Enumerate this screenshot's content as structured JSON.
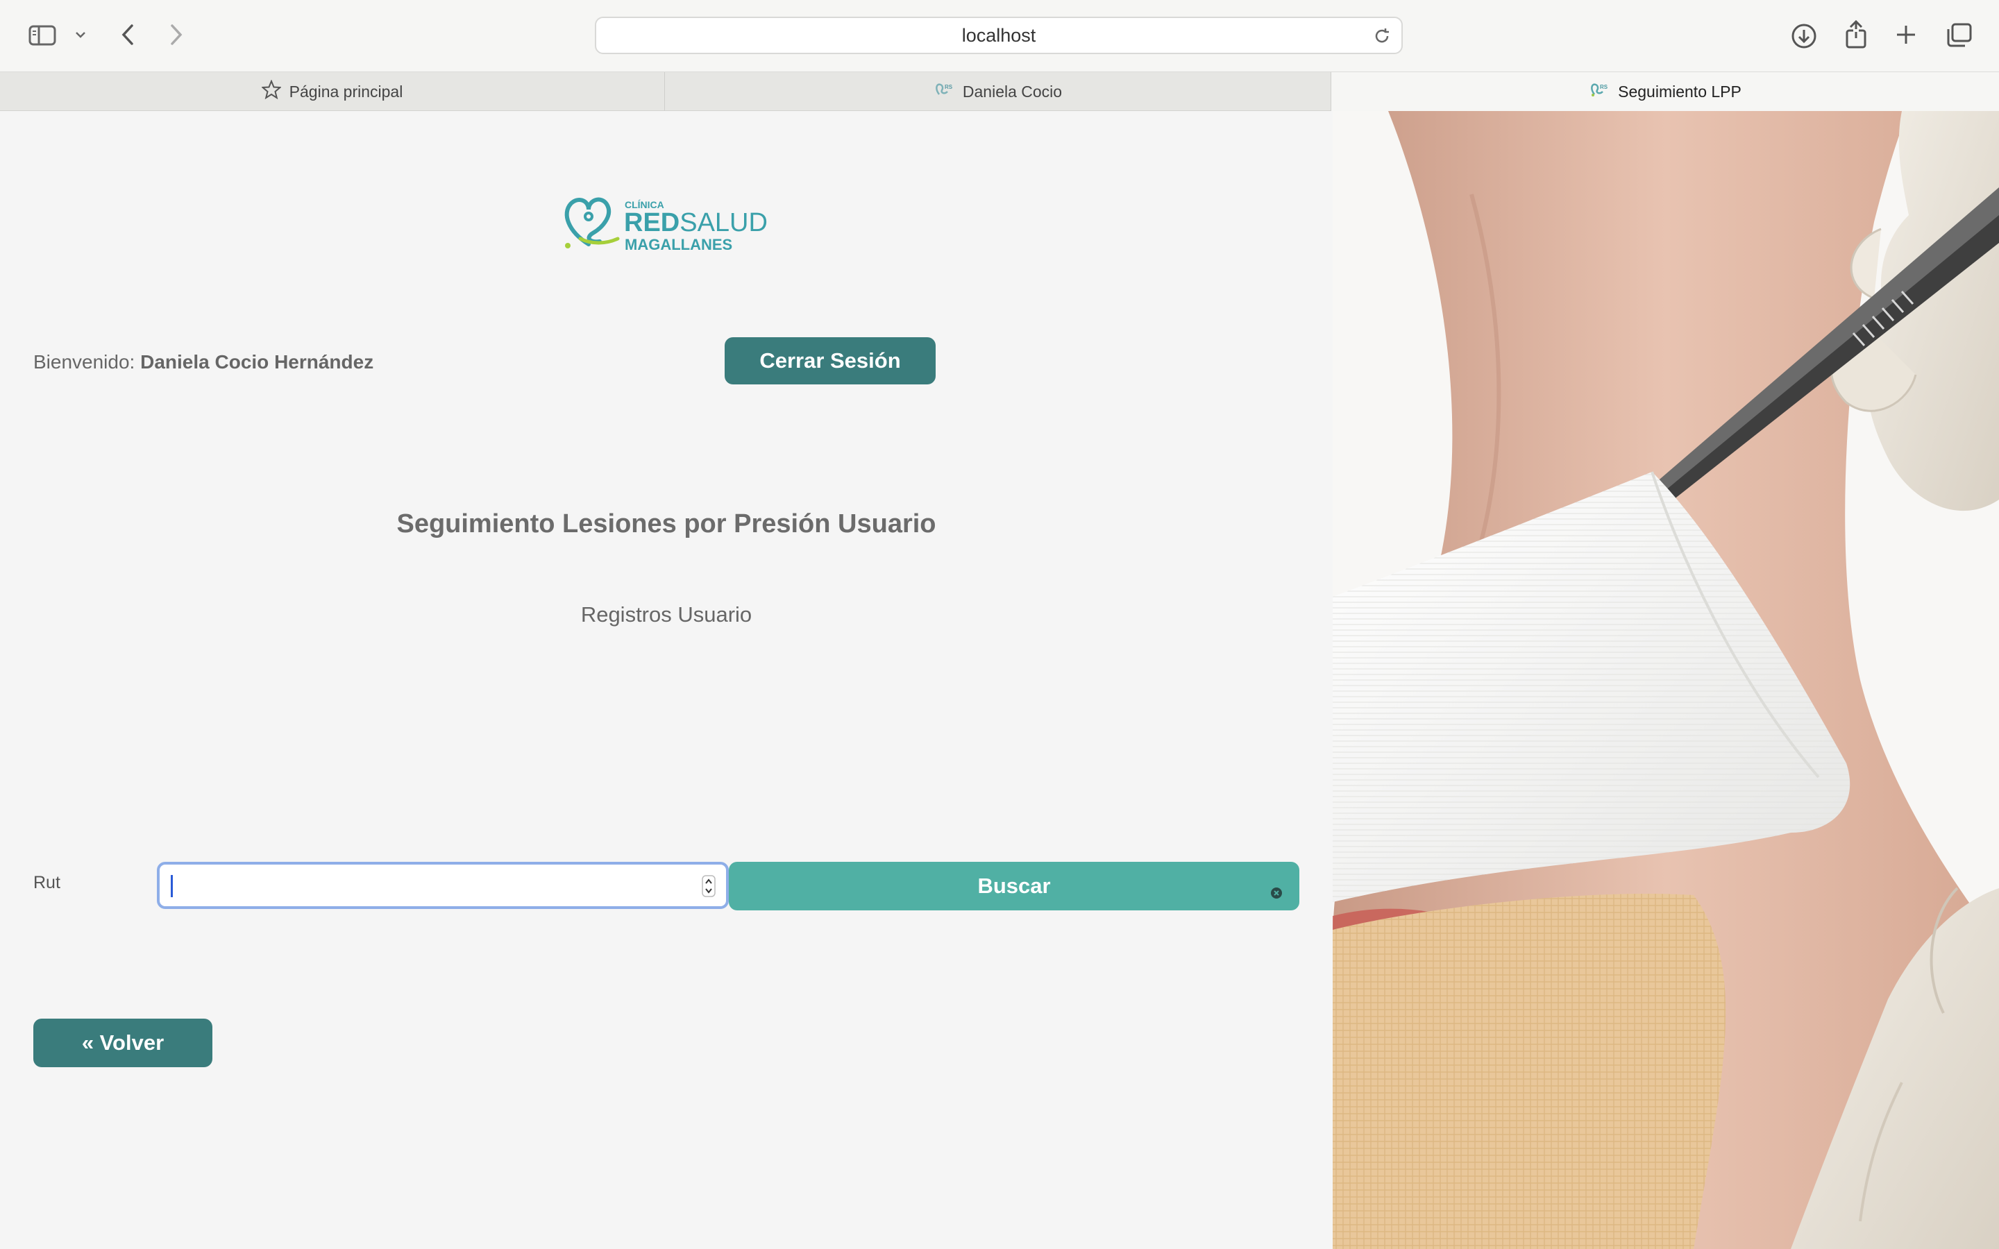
{
  "browser": {
    "url": "localhost",
    "tabs": [
      {
        "label": "Página principal",
        "icon": "star-icon"
      },
      {
        "label": "Daniela Cocio",
        "icon": "site-favicon"
      },
      {
        "label": "Seguimiento LPP",
        "icon": "site-favicon",
        "active": true
      }
    ]
  },
  "header": {
    "logo": {
      "top_text": "CLÍNICA",
      "main_text_bold": "RED",
      "main_text": "SALUD",
      "sub_text": "MAGALLANES"
    },
    "welcome_label": "Bienvenido:",
    "user_name": "Daniela Cocio Hernández",
    "logout_label": "Cerrar Sesión"
  },
  "main": {
    "title": "Seguimiento Lesiones por Presión Usuario",
    "subtitle": "Registros Usuario",
    "search": {
      "field_label": "Rut",
      "value": "",
      "button_label": "Buscar"
    },
    "back_label": "« Volver"
  },
  "colors": {
    "primary_teal": "#3a7c7c",
    "search_teal": "#50b0a4",
    "focus_ring": "#8eaee8",
    "page_bg": "#f5f5f5"
  }
}
